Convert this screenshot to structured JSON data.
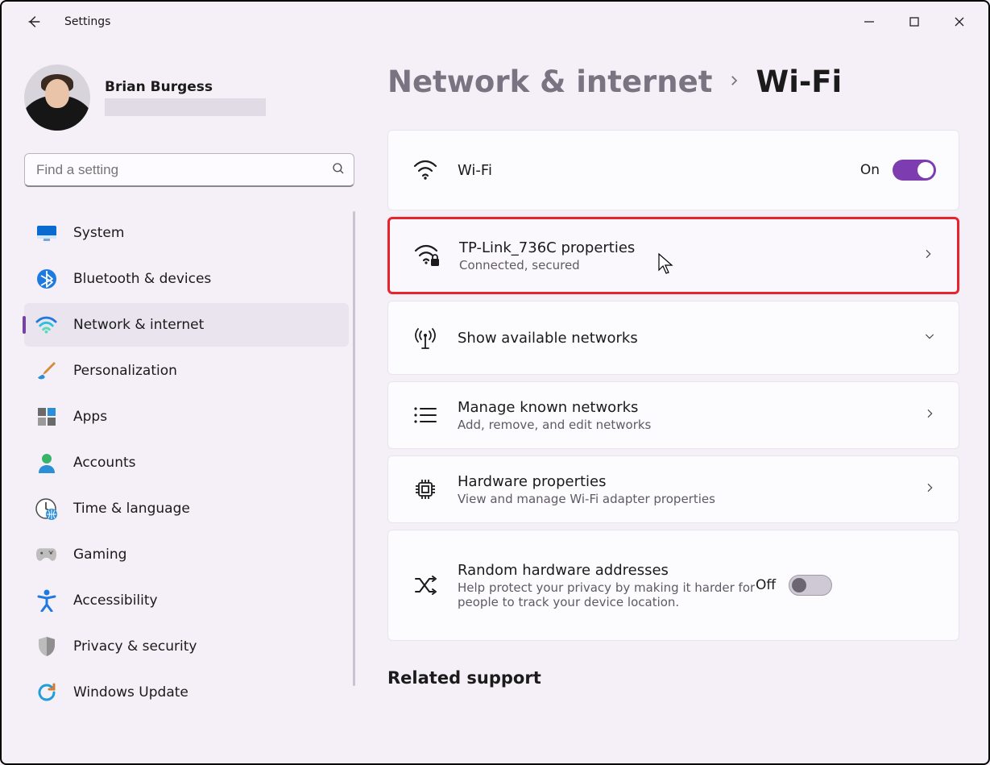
{
  "titlebar": {
    "title": "Settings"
  },
  "profile": {
    "name": "Brian Burgess"
  },
  "search": {
    "placeholder": "Find a setting"
  },
  "nav": {
    "items": [
      {
        "key": "system",
        "label": "System"
      },
      {
        "key": "bluetooth",
        "label": "Bluetooth & devices"
      },
      {
        "key": "network",
        "label": "Network & internet"
      },
      {
        "key": "personalization",
        "label": "Personalization"
      },
      {
        "key": "apps",
        "label": "Apps"
      },
      {
        "key": "accounts",
        "label": "Accounts"
      },
      {
        "key": "time",
        "label": "Time & language"
      },
      {
        "key": "gaming",
        "label": "Gaming"
      },
      {
        "key": "accessibility",
        "label": "Accessibility"
      },
      {
        "key": "privacy",
        "label": "Privacy & security"
      },
      {
        "key": "update",
        "label": "Windows Update"
      }
    ],
    "active": "network"
  },
  "breadcrumb": {
    "parent": "Network & internet",
    "current": "Wi-Fi"
  },
  "cards": {
    "wifi": {
      "title": "Wi-Fi",
      "state_label": "On",
      "on": true
    },
    "connection": {
      "title": "TP-Link_736C properties",
      "sub": "Connected, secured",
      "highlighted": true
    },
    "available": {
      "title": "Show available networks"
    },
    "known": {
      "title": "Manage known networks",
      "sub": "Add, remove, and edit networks"
    },
    "hardware": {
      "title": "Hardware properties",
      "sub": "View and manage Wi-Fi adapter properties"
    },
    "random": {
      "title": "Random hardware addresses",
      "sub": "Help protect your privacy by making it harder for people to track your device location.",
      "state_label": "Off",
      "on": false
    }
  },
  "related": {
    "heading": "Related support"
  }
}
